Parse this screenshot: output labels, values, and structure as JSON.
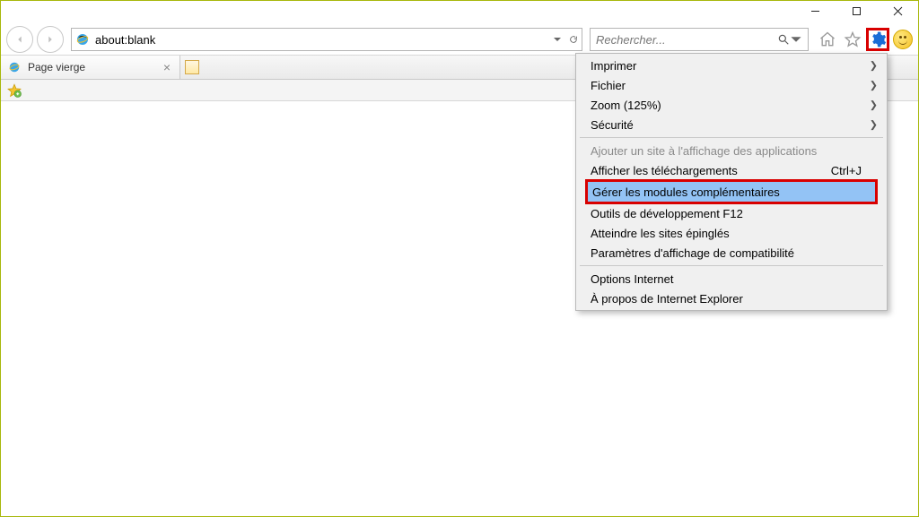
{
  "address": "about:blank",
  "search_placeholder": "Rechercher...",
  "tab": {
    "title": "Page vierge"
  },
  "menu": {
    "print": "Imprimer",
    "file": "Fichier",
    "zoom": "Zoom (125%)",
    "safety": "Sécurité",
    "add_app_view": "Ajouter un site à l'affichage des applications",
    "downloads": "Afficher les téléchargements",
    "downloads_shortcut": "Ctrl+J",
    "manage_addons": "Gérer les modules complémentaires",
    "f12": "Outils de développement F12",
    "pinned": "Atteindre les sites épinglés",
    "compat": "Paramètres d'affichage de compatibilité",
    "options": "Options Internet",
    "about": "À propos de Internet Explorer"
  }
}
